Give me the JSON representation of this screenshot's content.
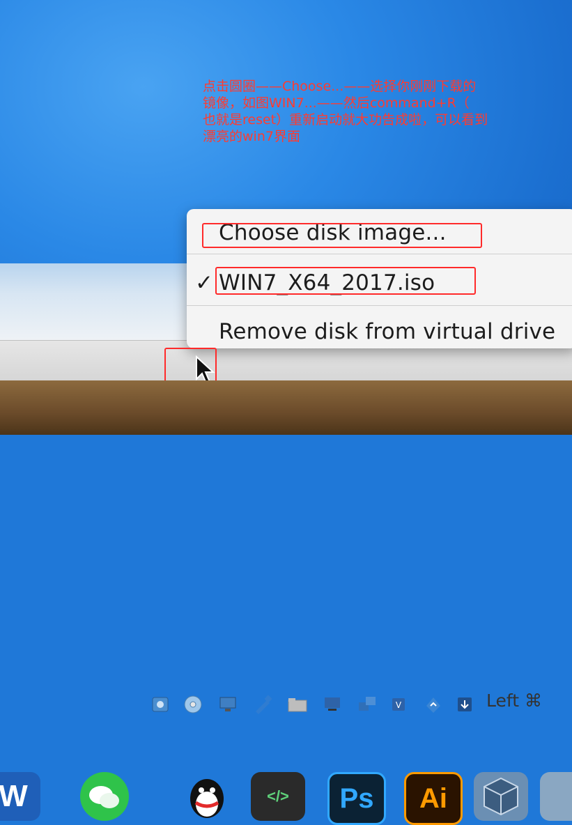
{
  "annotation": {
    "lines": [
      "点击圆圈——Choose...——选择你刚刚下载的",
      "镜像，如图WIN7...——然后command+R（",
      "也就是reset）重新启动就大功告成啦，可以看到",
      "漂亮的win7界面"
    ]
  },
  "disk_menu": {
    "items": [
      {
        "label": "Choose disk image...",
        "checked": false
      },
      {
        "label": "WIN7_X64_2017.iso",
        "checked": true
      },
      {
        "label": "Remove disk from virtual drive",
        "checked": false
      }
    ],
    "check_mark": "✓"
  },
  "statusbar": {
    "icons": [
      "hard-disk-icon",
      "optical-disk-icon",
      "display-icon",
      "usb-icon",
      "shared-folder-icon",
      "screen-icon",
      "network-icon",
      "cpu-icon",
      "mouse-integration-icon",
      "keyboard-icon"
    ],
    "host_key_label": "Left ⌘"
  },
  "dock": {
    "apps": [
      "W",
      "WeChat",
      "QQ",
      "</>",
      "Ps",
      "Ai",
      "VirtualBox",
      "Finder"
    ]
  },
  "colors": {
    "annotation_red": "#ff3b30",
    "desktop_blue": "#1f78d8",
    "menu_bg": "#f4f4f4"
  }
}
